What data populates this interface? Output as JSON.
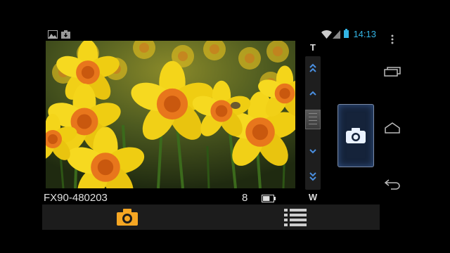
{
  "status_bar": {
    "time": "14:13",
    "icons": [
      "gallery-icon",
      "download-icon",
      "wifi-icon",
      "signal-icon",
      "battery-icon"
    ]
  },
  "camera": {
    "preview_subject": "yellow daffodils photo",
    "zoom": {
      "tele_label": "T",
      "wide_label": "W",
      "level": 0.5
    },
    "model_name": "FX90-480203",
    "remaining_shots": "8",
    "battery_level": 0.67,
    "shutter_icon": "camera-icon"
  },
  "bottom_bar": {
    "mode_icon": "camera-icon",
    "menu_icon": "list-menu-icon",
    "accent_color": "#f5a623"
  },
  "nav_bar": {
    "overflow_icon": "overflow-menu-icon",
    "recents_icon": "recent-apps-icon",
    "home_icon": "home-icon",
    "back_icon": "back-icon"
  }
}
